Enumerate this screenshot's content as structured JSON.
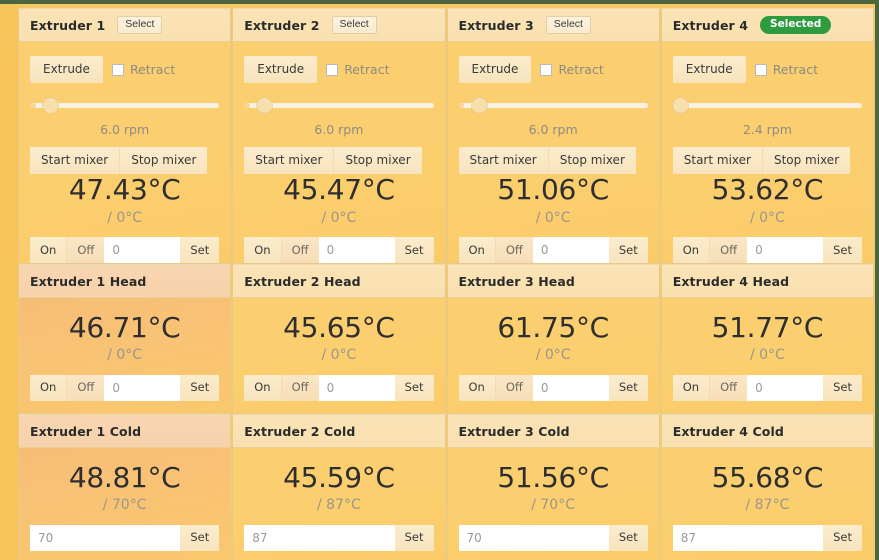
{
  "theme": {
    "frame_color": "#4a6741",
    "accent_green": "#2e9b3e",
    "panel_gold": "#fbcd6c",
    "header_cream": "#fae3b6"
  },
  "labels": {
    "select": "Select",
    "selected": "Selected",
    "extrude": "Extrude",
    "retract": "Retract",
    "start_mixer": "Start mixer",
    "stop_mixer": "Stop mixer",
    "on": "On",
    "off": "Off",
    "set": "Set"
  },
  "extruders": [
    {
      "title": "Extruder 1",
      "status": "Select",
      "is_selected": false,
      "retract_checked": false,
      "rpm_label": "6.0 rpm",
      "slider_percent": 8,
      "slider_fill_percent": 3,
      "temp_current": "47.43°C",
      "temp_target": "/ 0°C",
      "setpoint_value": "0",
      "tint": "warm2"
    },
    {
      "title": "Extruder 2",
      "status": "Select",
      "is_selected": false,
      "retract_checked": false,
      "rpm_label": "6.0 rpm",
      "slider_percent": 8,
      "slider_fill_percent": 3,
      "temp_current": "45.47°C",
      "temp_target": "/ 0°C",
      "setpoint_value": "0",
      "tint": "warm2"
    },
    {
      "title": "Extruder 3",
      "status": "Select",
      "is_selected": false,
      "retract_checked": false,
      "rpm_label": "6.0 rpm",
      "slider_percent": 8,
      "slider_fill_percent": 3,
      "temp_current": "51.06°C",
      "temp_target": "/ 0°C",
      "setpoint_value": "0",
      "tint": "warm2"
    },
    {
      "title": "Extruder 4",
      "status": "Selected",
      "is_selected": true,
      "retract_checked": false,
      "rpm_label": "2.4 rpm",
      "slider_percent": 1,
      "slider_fill_percent": 0,
      "temp_current": "53.62°C",
      "temp_target": "/ 0°C",
      "setpoint_value": "0",
      "tint": "warm2"
    }
  ],
  "heads": [
    {
      "title": "Extruder 1 Head",
      "temp_current": "46.71°C",
      "temp_target": "/ 0°C",
      "setpoint_value": "0",
      "tint": "warm"
    },
    {
      "title": "Extruder 2 Head",
      "temp_current": "45.65°C",
      "temp_target": "/ 0°C",
      "setpoint_value": "0",
      "tint": "warm2"
    },
    {
      "title": "Extruder 3 Head",
      "temp_current": "61.75°C",
      "temp_target": "/ 0°C",
      "setpoint_value": "0",
      "tint": "warm2"
    },
    {
      "title": "Extruder 4 Head",
      "temp_current": "51.77°C",
      "temp_target": "/ 0°C",
      "setpoint_value": "0",
      "tint": "warm2"
    }
  ],
  "colds": [
    {
      "title": "Extruder 1 Cold",
      "temp_current": "48.81°C",
      "temp_target": "/ 70°C",
      "setpoint_value": "70",
      "tint": "warm"
    },
    {
      "title": "Extruder 2 Cold",
      "temp_current": "45.59°C",
      "temp_target": "/ 87°C",
      "setpoint_value": "87",
      "tint": "warm2"
    },
    {
      "title": "Extruder 3 Cold",
      "temp_current": "51.56°C",
      "temp_target": "/ 70°C",
      "setpoint_value": "70",
      "tint": "warm2"
    },
    {
      "title": "Extruder 4 Cold",
      "temp_current": "55.68°C",
      "temp_target": "/ 87°C",
      "setpoint_value": "87",
      "tint": "warm2"
    }
  ]
}
